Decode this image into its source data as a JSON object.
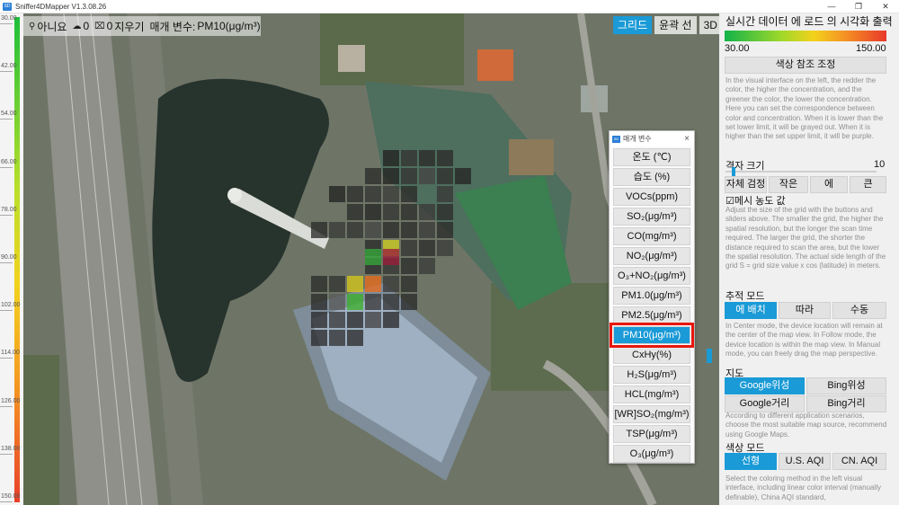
{
  "window": {
    "title": "Sniffer4DMapper V1.3.08.26",
    "controls": [
      "—",
      "❐",
      "✕"
    ]
  },
  "legend": {
    "ticks": [
      "30.00",
      "42.00",
      "54.00",
      "66.00",
      "78.00",
      "90.00",
      "102.00",
      "114.00",
      "126.00",
      "138.00",
      "150.00"
    ]
  },
  "toolbar": {
    "no_label": "아니요",
    "count_a": "0",
    "count_b": "0",
    "clear_label": "지우기",
    "variable_label": "매개 변수:",
    "variable_value": "PM10(μg/m³)",
    "grid_label": "그리드",
    "contour_label": "윤곽 선",
    "three_d_label": "3D"
  },
  "var_panel": {
    "title": "매개 변수",
    "close": "×",
    "items": [
      "온도 (℃)",
      "습도 (%)",
      "VOCs(ppm)",
      "SO₂(μg/m³)",
      "CO(mg/m³)",
      "NO₂(μg/m³)",
      "O₃+NO₂(μg/m³)",
      "PM1.0(μg/m³)",
      "PM2.5(μg/m³)",
      "PM10(μg/m³)",
      "CxHy(%)",
      "H₂S(μg/m³)",
      "HCL(mg/m³)",
      "[WR]SO₂(mg/m³)",
      "TSP(μg/m³)",
      "O₃(μg/m³)"
    ],
    "selected": "PM10(μg/m³)"
  },
  "right_panel": {
    "title": "실시간 데이터 에 로드 의 시각화 출력",
    "gradient_min": "30.00",
    "gradient_max": "150.00",
    "color_ref_button": "색상 참조 조정",
    "color_desc": "In the visual interface on the left, the redder the color, the higher the concentration, and the greener the color, the lower the concentration. Here you can set the correspondence between color and concentration. When it is lower than the set lower limit, it will be grayed out. When it is higher than the set upper limit, it will be purple.",
    "grid_size_label": "격자 크기",
    "grid_size_value": "10",
    "grid_buttons": [
      "자체 검정",
      "작은",
      "에",
      "큰"
    ],
    "mesh_label": "☑메시 농도 값",
    "grid_desc": "Adjust the size of the grid with the buttons and sliders above. The smaller the grid, the higher the spatial resolution, but the longer the scan time required. The larger the grid, the shorter the distance required to scan the area, but the lower the spatial resolution. The actual side length of the grid S = grid size value x cos (latitude) in meters.",
    "tracking_label": "추적 모드",
    "tracking_buttons": [
      "에 배치",
      "따라",
      "수동"
    ],
    "tracking_selected": 0,
    "tracking_desc": "In Center mode, the device location will remain at the center of the map view. In Follow mode, the device location is within the map view. In Manual mode, you can freely drag the map perspective.",
    "map_label": "지도",
    "map_buttons": [
      "Google위성",
      "Bing위성",
      "Google거리",
      "Bing거리"
    ],
    "map_selected": 0,
    "map_desc": "According to different application scenarios, choose the most suitable map source, recommend using Google Maps.",
    "color_mode_label": "색상 모드",
    "color_mode_buttons": [
      "선형",
      "U.S. AQI",
      "CN. AQI"
    ],
    "color_mode_selected": 0,
    "color_mode_desc": "Select the coloring method in the left visual interface, including linear color interval (manually definable), China AQI standard,"
  },
  "colors": {
    "accent": "#1a9ad6",
    "highlight": "#e8160c"
  }
}
